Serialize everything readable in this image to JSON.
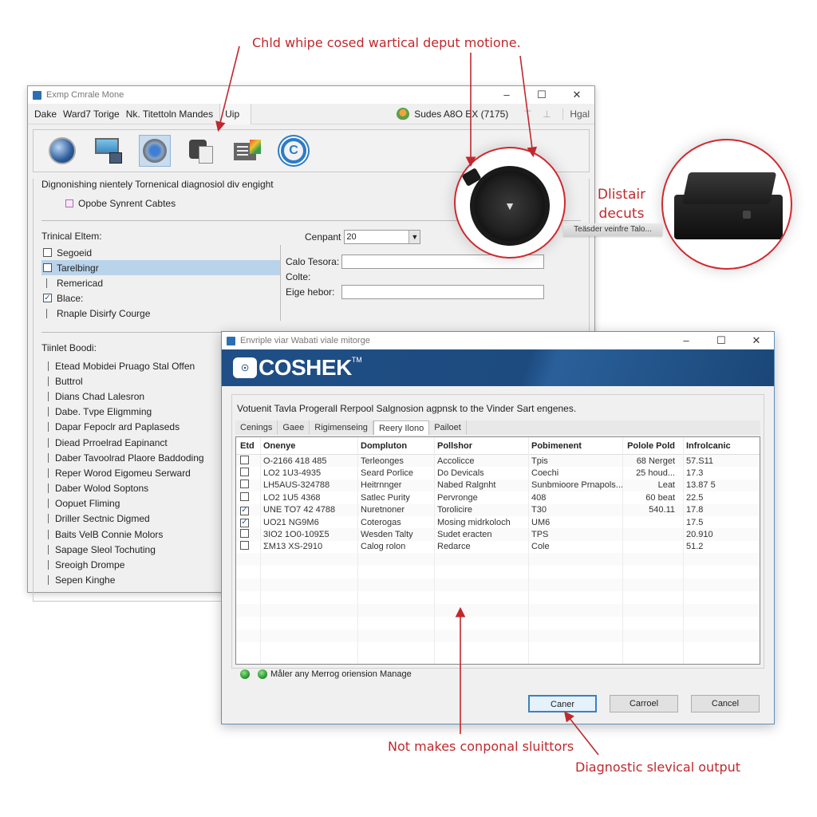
{
  "annotations": {
    "top": "Chld whipe cosed wartical deput motione.",
    "bottom": "Not makes conponal sluittors",
    "bottom_right": "Diagnostic slevical output"
  },
  "window1": {
    "title": "Exmp Cmrale Mone",
    "controls": {
      "minimize": "–",
      "maximize": "☐",
      "close": "✕"
    },
    "menu": [
      "Dake",
      "Ward7 Torige",
      "Nk. Titettoln Mandes",
      "Uip"
    ],
    "status_text": "Sudes A8O EX (7175)",
    "help_label": "Hgal",
    "toolbar_icons": [
      "gauge-icon",
      "monitor-icon",
      "lens-icon",
      "printer-icon",
      "document-chart-icon",
      "cog-icon"
    ],
    "description": "Dignonishing nientely Tornenical diagnosiol div engight",
    "option_label": "Opobe Synrent Cabtes",
    "elements_label": "Trinical Eltem:",
    "elements": [
      {
        "label": "Segoeid",
        "type": "checkbox",
        "checked": false,
        "selected": false
      },
      {
        "label": "Tarelbingr",
        "type": "checkbox",
        "checked": false,
        "selected": true
      },
      {
        "label": "Remericad",
        "type": "tree",
        "checked": false,
        "selected": false
      },
      {
        "label": "Blace:",
        "type": "checkbox",
        "checked": true,
        "selected": false
      },
      {
        "label": "Rnaple Disirfy Courge",
        "type": "tree",
        "checked": false,
        "selected": false
      }
    ],
    "component_label": "Cenpant",
    "component_value": "20",
    "form": {
      "calo_label": "Calo Tesora:",
      "calo_value": "",
      "coffe_label": "Colte:",
      "edge_label": "Eige hebor:",
      "edge_value": ""
    },
    "list_label": "Tiinlet Boodi:",
    "list_items": [
      "Etead Mobidei Pruago Stal Offen",
      "Buttrol",
      "Dians Chad Lalesron",
      "Dabe. Tvpe Eligmming",
      "Dapar Fepoclr ard Paplaseds",
      "Diead Prroelrad Eapinanct",
      "Daber Tavoolrad Plaore Baddoding",
      "Reper Worod Eigomeu Serward",
      "Daber Wolod Soptons",
      "Oopuet Fliming",
      "Driller Sectnic Digmed",
      "Baits VelB Connie Molors",
      "Sapage Sleol Tochuting",
      "Sreoigh Drompe",
      "Sepen Kinghe"
    ]
  },
  "callout": {
    "title": "Dlistair decuts",
    "tag": "Teäsder veinfre Talo...",
    "left_device": "obd-puck-device",
    "right_device": "obd-box-device",
    "accent": "#c0282d"
  },
  "window2": {
    "title": "Envriple viar Wabati viale mitorge",
    "controls": {
      "minimize": "–",
      "maximize": "☐",
      "close": "✕"
    },
    "brand": "COSHEK",
    "brand_tm": "TM",
    "brand_color": "#1d4b80",
    "description": "Votuenit Tavla Progerall Rerpool Salgnosion agpnsk to the Vinder Sart engenes.",
    "tabs": [
      "Cenings",
      "Gaee",
      "Rigimenseing",
      "Reery Ilono",
      "Pailoet"
    ],
    "active_tab": 3,
    "columns": [
      "Etd",
      "Onenye",
      "Dompluton",
      "Pollshor",
      "Pobimenent",
      "Polole Pold",
      "Infrolcanic"
    ],
    "rows": [
      {
        "checked": false,
        "cells": [
          "O-2166 418 485",
          "Terleonges",
          "Accolicce",
          "Tpis",
          "68 Nerget",
          "57.S11"
        ]
      },
      {
        "checked": false,
        "cells": [
          "LO2 1U3-4935",
          "Seard Porlice",
          "Do Devicals",
          "Coechi",
          "25 houd...",
          "17.3"
        ]
      },
      {
        "checked": false,
        "cells": [
          "LH5AUS-324788",
          "Heitrnnger",
          "Nabed Ralgnht",
          "Sunbmioore Prnapols...",
          "Leat",
          "13.87 5"
        ]
      },
      {
        "checked": false,
        "cells": [
          "LO2 1U5 4368",
          "Satlec Purity",
          "Pervronge",
          "408",
          "60 beat",
          "22.5"
        ]
      },
      {
        "checked": true,
        "cells": [
          "UNE TO7 42 4788",
          "Nuretnoner",
          "Torolicire",
          "T30",
          "540.11",
          "17.8"
        ]
      },
      {
        "checked": true,
        "cells": [
          "UO21 NG9M6",
          "Coterogas",
          "Mosing midrkoloch",
          "UM6",
          "",
          "17.5"
        ]
      },
      {
        "checked": false,
        "cells": [
          "3IO2 1O0-109Σ5",
          "Wesden Talty",
          "Sudet eracten",
          "TPS",
          "",
          "20.910"
        ]
      },
      {
        "checked": false,
        "cells": [
          "ΣM13 XS-2910",
          "Calog rolon",
          "Redarce",
          "Cole",
          "",
          "51.2"
        ]
      }
    ],
    "status_text": "Måler any Merrog oriension Manage",
    "buttons": [
      "Caner",
      "Carroel",
      "Cancel"
    ]
  }
}
